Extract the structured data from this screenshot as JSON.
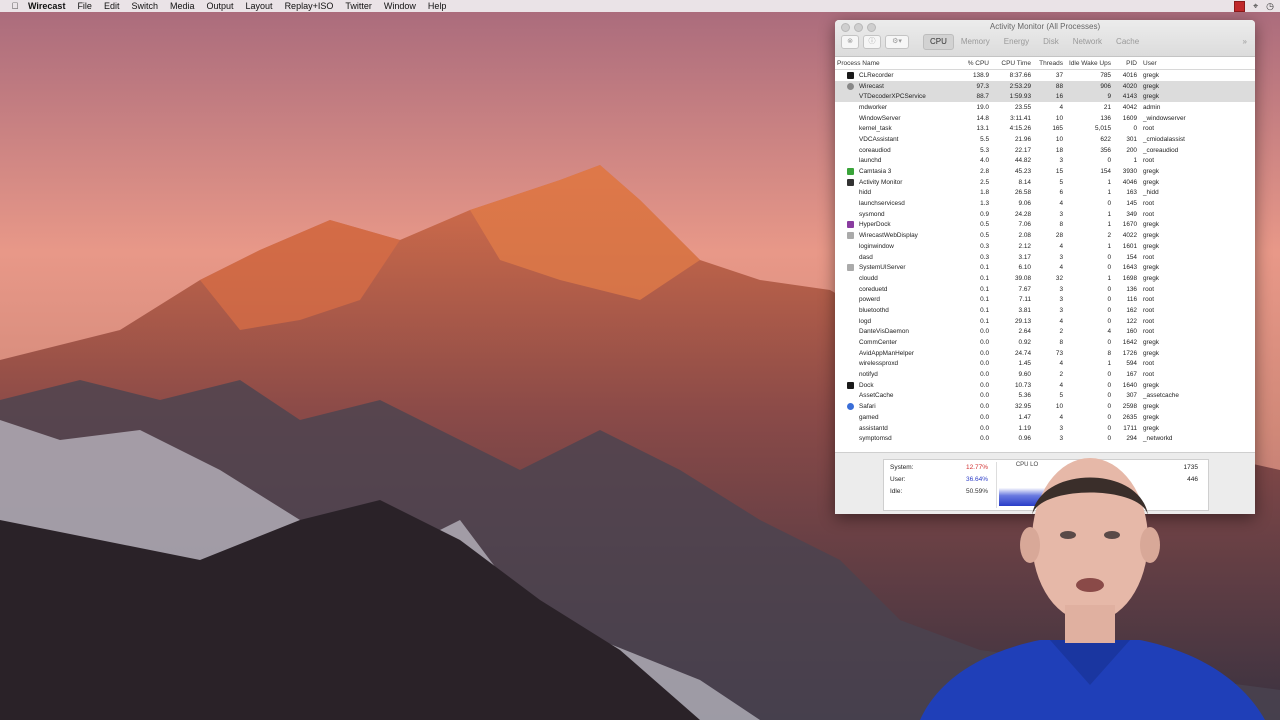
{
  "menubar": {
    "apple_icon": "apple-icon",
    "app_name": "Wirecast",
    "items": [
      "File",
      "Edit",
      "Switch",
      "Media",
      "Output",
      "Layout",
      "Replay+ISO",
      "Twitter",
      "Window",
      "Help"
    ]
  },
  "activity_monitor": {
    "title": "Activity Monitor (All Processes)",
    "tabs": [
      "CPU",
      "Memory",
      "Energy",
      "Disk",
      "Network",
      "Cache"
    ],
    "active_tab": "CPU",
    "columns": [
      "Process Name",
      "% CPU",
      "CPU Time",
      "Threads",
      "Idle Wake Ups",
      "PID",
      "User"
    ],
    "rows": [
      {
        "icon": "black",
        "name": "CLRecorder",
        "cpu": "138.9",
        "time": "8:37.66",
        "threads": "37",
        "wake": "785",
        "pid": "4016",
        "user": "gregk"
      },
      {
        "icon": "gear",
        "name": "Wirecast",
        "cpu": "97.3",
        "time": "2:53.29",
        "threads": "88",
        "wake": "906",
        "pid": "4020",
        "user": "gregk"
      },
      {
        "icon": "none",
        "name": "VTDecoderXPCService",
        "cpu": "88.7",
        "time": "1:59.93",
        "threads": "16",
        "wake": "9",
        "pid": "4143",
        "user": "gregk"
      },
      {
        "icon": "none",
        "name": "mdworker",
        "cpu": "19.0",
        "time": "23.55",
        "threads": "4",
        "wake": "21",
        "pid": "4042",
        "user": "admin"
      },
      {
        "icon": "none",
        "name": "WindowServer",
        "cpu": "14.8",
        "time": "3:11.41",
        "threads": "10",
        "wake": "136",
        "pid": "1609",
        "user": "_windowserver"
      },
      {
        "icon": "none",
        "name": "kernel_task",
        "cpu": "13.1",
        "time": "4:15.26",
        "threads": "165",
        "wake": "5,015",
        "pid": "0",
        "user": "root"
      },
      {
        "icon": "none",
        "name": "VDCAssistant",
        "cpu": "5.5",
        "time": "21.96",
        "threads": "10",
        "wake": "622",
        "pid": "301",
        "user": "_cmiodalassist"
      },
      {
        "icon": "none",
        "name": "coreaudiod",
        "cpu": "5.3",
        "time": "22.17",
        "threads": "18",
        "wake": "356",
        "pid": "200",
        "user": "_coreaudiod"
      },
      {
        "icon": "none",
        "name": "launchd",
        "cpu": "4.0",
        "time": "44.82",
        "threads": "3",
        "wake": "0",
        "pid": "1",
        "user": "root"
      },
      {
        "icon": "green",
        "name": "Camtasia 3",
        "cpu": "2.8",
        "time": "45.23",
        "threads": "15",
        "wake": "154",
        "pid": "3930",
        "user": "gregk"
      },
      {
        "icon": "dark",
        "name": "Activity Monitor",
        "cpu": "2.5",
        "time": "8.14",
        "threads": "5",
        "wake": "1",
        "pid": "4046",
        "user": "gregk"
      },
      {
        "icon": "none",
        "name": "hidd",
        "cpu": "1.8",
        "time": "26.58",
        "threads": "6",
        "wake": "1",
        "pid": "163",
        "user": "_hidd"
      },
      {
        "icon": "none",
        "name": "launchservicesd",
        "cpu": "1.3",
        "time": "9.06",
        "threads": "4",
        "wake": "0",
        "pid": "145",
        "user": "root"
      },
      {
        "icon": "none",
        "name": "sysmond",
        "cpu": "0.9",
        "time": "24.28",
        "threads": "3",
        "wake": "1",
        "pid": "349",
        "user": "root"
      },
      {
        "icon": "purple",
        "name": "HyperDock",
        "cpu": "0.5",
        "time": "7.06",
        "threads": "8",
        "wake": "1",
        "pid": "1670",
        "user": "gregk"
      },
      {
        "icon": "cam",
        "name": "WirecastWebDisplay",
        "cpu": "0.5",
        "time": "2.08",
        "threads": "28",
        "wake": "2",
        "pid": "4022",
        "user": "gregk"
      },
      {
        "icon": "none",
        "name": "loginwindow",
        "cpu": "0.3",
        "time": "2.12",
        "threads": "4",
        "wake": "1",
        "pid": "1601",
        "user": "gregk"
      },
      {
        "icon": "none",
        "name": "dasd",
        "cpu": "0.3",
        "time": "3.17",
        "threads": "3",
        "wake": "0",
        "pid": "154",
        "user": "root"
      },
      {
        "icon": "cam",
        "name": "SystemUIServer",
        "cpu": "0.1",
        "time": "6.10",
        "threads": "4",
        "wake": "0",
        "pid": "1643",
        "user": "gregk"
      },
      {
        "icon": "none",
        "name": "cloudd",
        "cpu": "0.1",
        "time": "39.08",
        "threads": "32",
        "wake": "1",
        "pid": "1698",
        "user": "gregk"
      },
      {
        "icon": "none",
        "name": "coreduetd",
        "cpu": "0.1",
        "time": "7.67",
        "threads": "3",
        "wake": "0",
        "pid": "136",
        "user": "root"
      },
      {
        "icon": "none",
        "name": "powerd",
        "cpu": "0.1",
        "time": "7.11",
        "threads": "3",
        "wake": "0",
        "pid": "116",
        "user": "root"
      },
      {
        "icon": "none",
        "name": "bluetoothd",
        "cpu": "0.1",
        "time": "3.81",
        "threads": "3",
        "wake": "0",
        "pid": "162",
        "user": "root"
      },
      {
        "icon": "none",
        "name": "logd",
        "cpu": "0.1",
        "time": "29.13",
        "threads": "4",
        "wake": "0",
        "pid": "122",
        "user": "root"
      },
      {
        "icon": "none",
        "name": "DanteVisDaemon",
        "cpu": "0.0",
        "time": "2.64",
        "threads": "2",
        "wake": "4",
        "pid": "160",
        "user": "root"
      },
      {
        "icon": "none",
        "name": "CommCenter",
        "cpu": "0.0",
        "time": "0.92",
        "threads": "8",
        "wake": "0",
        "pid": "1642",
        "user": "gregk"
      },
      {
        "icon": "none",
        "name": "AvidAppManHelper",
        "cpu": "0.0",
        "time": "24.74",
        "threads": "73",
        "wake": "8",
        "pid": "1726",
        "user": "gregk"
      },
      {
        "icon": "none",
        "name": "wirelessproxd",
        "cpu": "0.0",
        "time": "1.45",
        "threads": "4",
        "wake": "1",
        "pid": "594",
        "user": "root"
      },
      {
        "icon": "none",
        "name": "notifyd",
        "cpu": "0.0",
        "time": "9.60",
        "threads": "2",
        "wake": "0",
        "pid": "167",
        "user": "root"
      },
      {
        "icon": "black",
        "name": "Dock",
        "cpu": "0.0",
        "time": "10.73",
        "threads": "4",
        "wake": "0",
        "pid": "1640",
        "user": "gregk"
      },
      {
        "icon": "none",
        "name": "AssetCache",
        "cpu": "0.0",
        "time": "5.36",
        "threads": "5",
        "wake": "0",
        "pid": "307",
        "user": "_assetcache"
      },
      {
        "icon": "globe",
        "name": "Safari",
        "cpu": "0.0",
        "time": "32.95",
        "threads": "10",
        "wake": "0",
        "pid": "2598",
        "user": "gregk"
      },
      {
        "icon": "none",
        "name": "gamed",
        "cpu": "0.0",
        "time": "1.47",
        "threads": "4",
        "wake": "0",
        "pid": "2635",
        "user": "gregk"
      },
      {
        "icon": "none",
        "name": "assistantd",
        "cpu": "0.0",
        "time": "1.19",
        "threads": "3",
        "wake": "0",
        "pid": "1711",
        "user": "gregk"
      },
      {
        "icon": "none",
        "name": "symptomsd",
        "cpu": "0.0",
        "time": "0.96",
        "threads": "3",
        "wake": "0",
        "pid": "294",
        "user": "_networkd"
      }
    ],
    "stats": {
      "system_label": "System:",
      "system_value": "12.77%",
      "user_label": "User:",
      "user_value": "36.64%",
      "idle_label": "Idle:",
      "idle_value": "50.59%",
      "cpu_load_label": "CPU LO",
      "threads_value": "1735",
      "processes_value": "446"
    }
  }
}
